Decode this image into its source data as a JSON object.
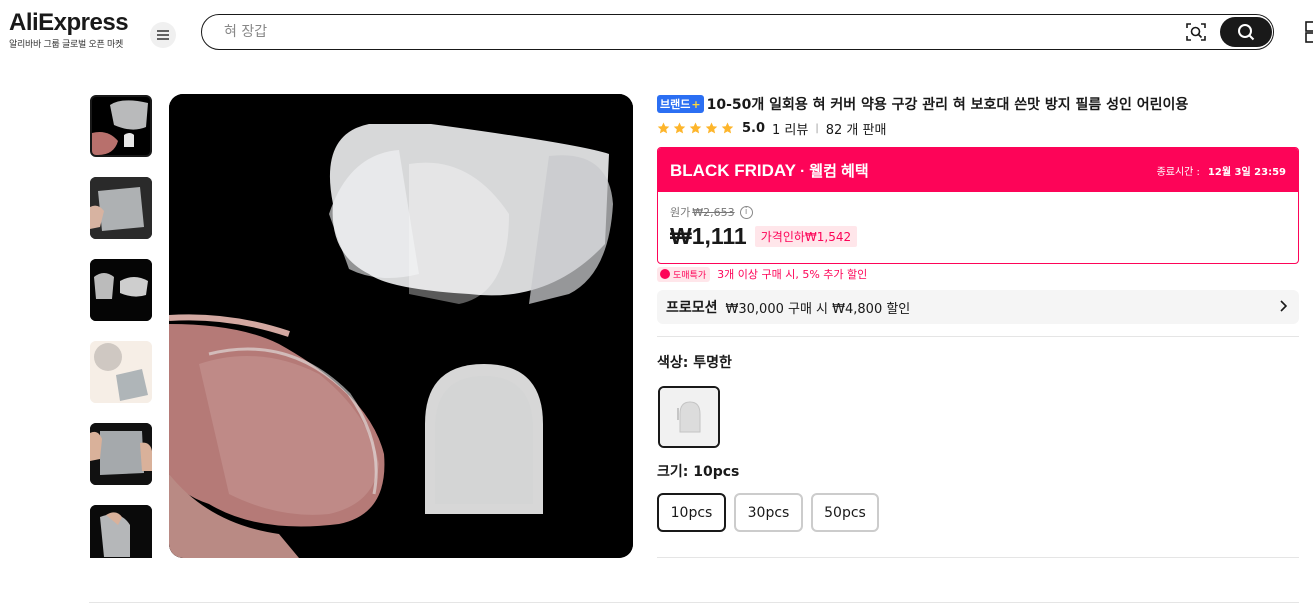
{
  "header": {
    "logo_text": "AliExpress",
    "logo_sub": "알리바바 그룹 글로벌 오픈 마켓",
    "search_placeholder": "혀 장갑",
    "icons": [
      "menu-icon",
      "camera-search-icon",
      "search-icon"
    ]
  },
  "gallery": {
    "thumbnail_count": 6,
    "active_index": 0
  },
  "product": {
    "brand_badge": "브랜드",
    "brand_plus": "+",
    "title": "10-50개 일회용 혀 커버 약용 구강 관리 혀 보호대 쓴맛 방지 필름 성인 어린이용",
    "rating": "5.0",
    "reviews": "1 리뷰",
    "sold": "82 개 판매",
    "stars": 5
  },
  "deal": {
    "title": "BLACK FRIDAY",
    "subtitle": " · 웰컴 혜택",
    "end_label": "종료시간 :",
    "end_time": "12월 3일 23:59",
    "original_label": "원가",
    "original_price": "₩2,653",
    "price": "₩1,111",
    "drop_badge": "가격인하₩1,542",
    "accent_color": "#fd0458"
  },
  "wholesale": {
    "tag": "도매특가",
    "text": "3개 이상 구매 시, 5% 추가 할인"
  },
  "promotion": {
    "label": "프로모션",
    "text": "₩30,000 구매 시 ₩4,800 할인"
  },
  "variants": {
    "color_label": "색상: 투명한",
    "size_label": "크기: 10pcs",
    "sizes": [
      "10pcs",
      "30pcs",
      "50pcs"
    ],
    "selected_size": "10pcs"
  }
}
